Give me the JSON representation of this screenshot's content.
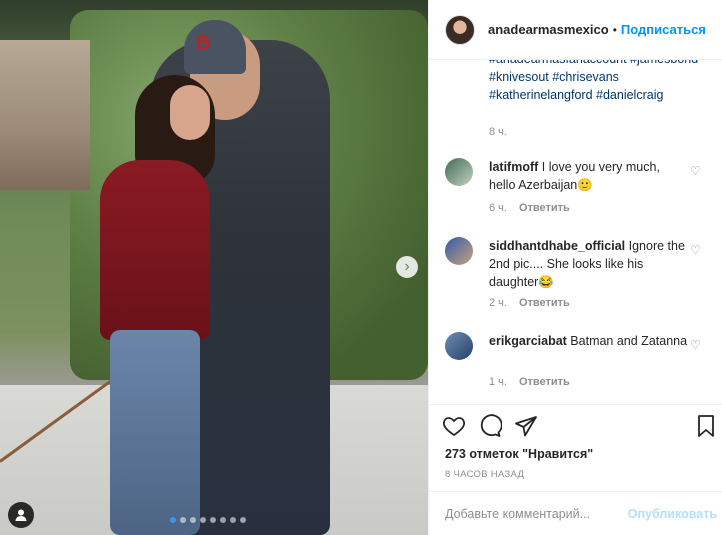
{
  "post": {
    "username": "anadearmasmexico",
    "separator": "•",
    "follow_label": "Подписаться",
    "caption_hashtags": "#anadearmasfanaccount #jamesbond #knivesout #chrisevans #katherinelangford #danielcraig",
    "caption_time": "8 ч."
  },
  "comments": [
    {
      "username": "latifmoff",
      "text": " I love you very much, hello Azerbaijan🙂",
      "time": "6 ч.",
      "reply": "Ответить"
    },
    {
      "username": "siddhantdhabe_official",
      "text": " Ignore the 2nd pic.... She looks like his daughter😂",
      "time": "2 ч.",
      "reply": "Ответить"
    },
    {
      "username": "erikgarciabat",
      "text": " Batman and Zatanna",
      "time": "1 ч.",
      "reply": "Ответить"
    }
  ],
  "actions": {
    "likes": "273 отметок \"Нравится\"",
    "time_ago": "8 ЧАСОВ НАЗАД"
  },
  "composer": {
    "placeholder": "Добавьте комментарий...",
    "post_label": "Опубликовать"
  },
  "colors": {
    "link": "#00376b",
    "follow": "#0095f6",
    "post_disabled": "#b2dffc"
  }
}
